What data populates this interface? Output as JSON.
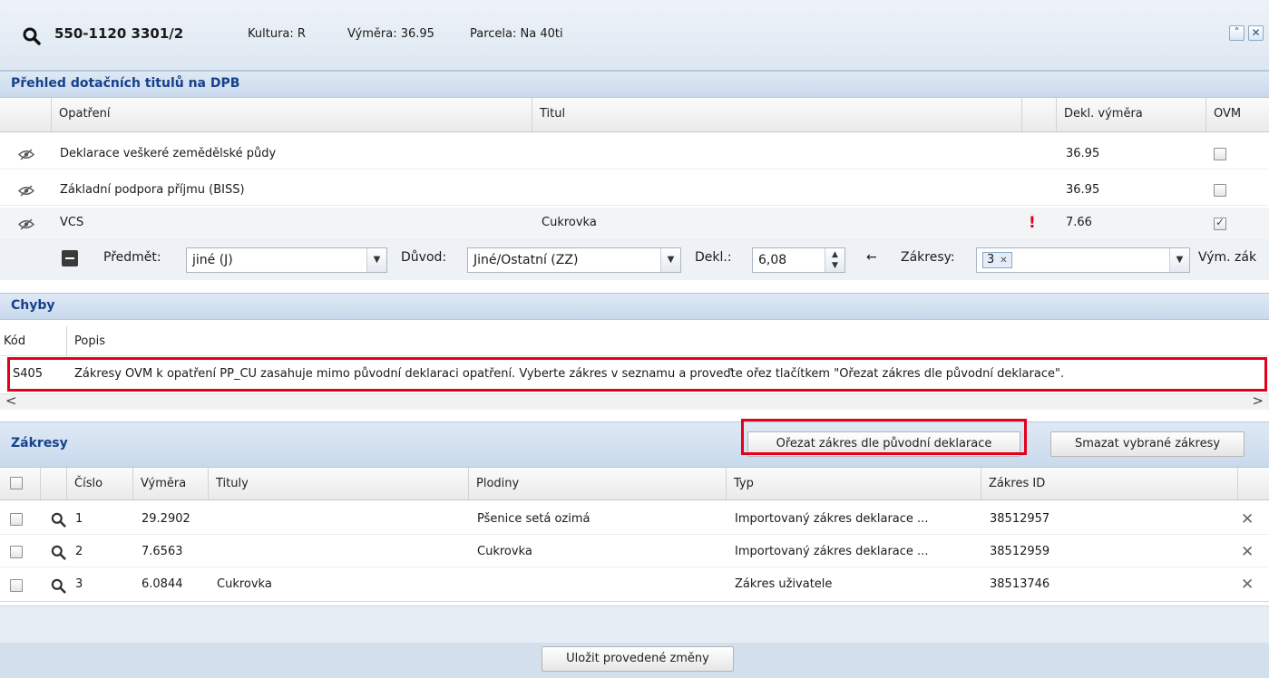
{
  "header": {
    "parcel_id": "550-1120 3301/2",
    "kultura": "Kultura: R",
    "vymera": "Výměra: 36.95",
    "parcela": "Parcela: Na 40ti",
    "collapse_icon": "double-chevron-up-icon",
    "close_icon": "close-icon"
  },
  "dotace": {
    "title": "Přehled dotačních titulů na DPB",
    "columns": {
      "opatreni": "Opatření",
      "titul": "Titul",
      "dekl_vymera": "Dekl. výměra",
      "ovm": "OVM"
    },
    "rows": [
      {
        "opatreni": "Deklarace veškeré zemědělské půdy",
        "titul": "",
        "warning": "",
        "dekl_vymera": "36.95",
        "ovm": false
      },
      {
        "opatreni": "Základní podpora příjmu (BISS)",
        "titul": "",
        "warning": "",
        "dekl_vymera": "36.95",
        "ovm": false
      },
      {
        "opatreni": "VCS",
        "titul": "Cukrovka",
        "warning": "!",
        "dekl_vymera": "7.66",
        "ovm": true
      }
    ]
  },
  "detail_form": {
    "predmet_label": "Předmět:",
    "predmet_value": "jiné (J)",
    "duvod_label": "Důvod:",
    "duvod_value": "Jiné/Ostatní (ZZ)",
    "dekl_label": "Dekl.:",
    "dekl_value": "6,08",
    "arrow_glyph": "←",
    "zakresy_label": "Zákresy:",
    "zakresy_tag": "3",
    "vym_label": "Vým. zák"
  },
  "chyby": {
    "title": "Chyby",
    "columns": {
      "kod": "Kód",
      "popis": "Popis"
    },
    "rows": [
      {
        "kod": "S405",
        "popis": "Zákresy OVM k opatření PP_CU zasahuje mimo původní deklaraci opatření. Vyberte zákres v seznamu a proveďte ořez tlačítkem \"Ořezat zákres dle původní deklarace\"."
      }
    ],
    "scroll_left": "<",
    "scroll_right": ">"
  },
  "zakresy": {
    "title": "Zákresy",
    "btn_orezat": "Ořezat zákres dle původní deklarace",
    "btn_smazat": "Smazat vybrané zákresy",
    "columns": {
      "cislo": "Číslo",
      "vymera": "Výměra",
      "tituly": "Tituly",
      "plodiny": "Plodiny",
      "typ": "Typ",
      "zakres_id": "Zákres ID"
    },
    "rows": [
      {
        "cislo": "1",
        "vymera": "29.2902",
        "tituly": "",
        "plodiny": "Pšenice setá ozimá",
        "typ": "Importovaný zákres deklarace ...",
        "zakres_id": "38512957"
      },
      {
        "cislo": "2",
        "vymera": "7.6563",
        "tituly": "",
        "plodiny": "Cukrovka",
        "typ": "Importovaný zákres deklarace ...",
        "zakres_id": "38512959"
      },
      {
        "cislo": "3",
        "vymera": "6.0844",
        "tituly": "Cukrovka",
        "plodiny": "",
        "typ": "Zákres uživatele",
        "zakres_id": "38513746"
      }
    ],
    "delete_glyph": "✕"
  },
  "footer": {
    "save_label": "Uložit provedené změny"
  },
  "colors": {
    "accent": "#15428b",
    "highlight": "#e3001b",
    "warning": "#e3001b"
  }
}
